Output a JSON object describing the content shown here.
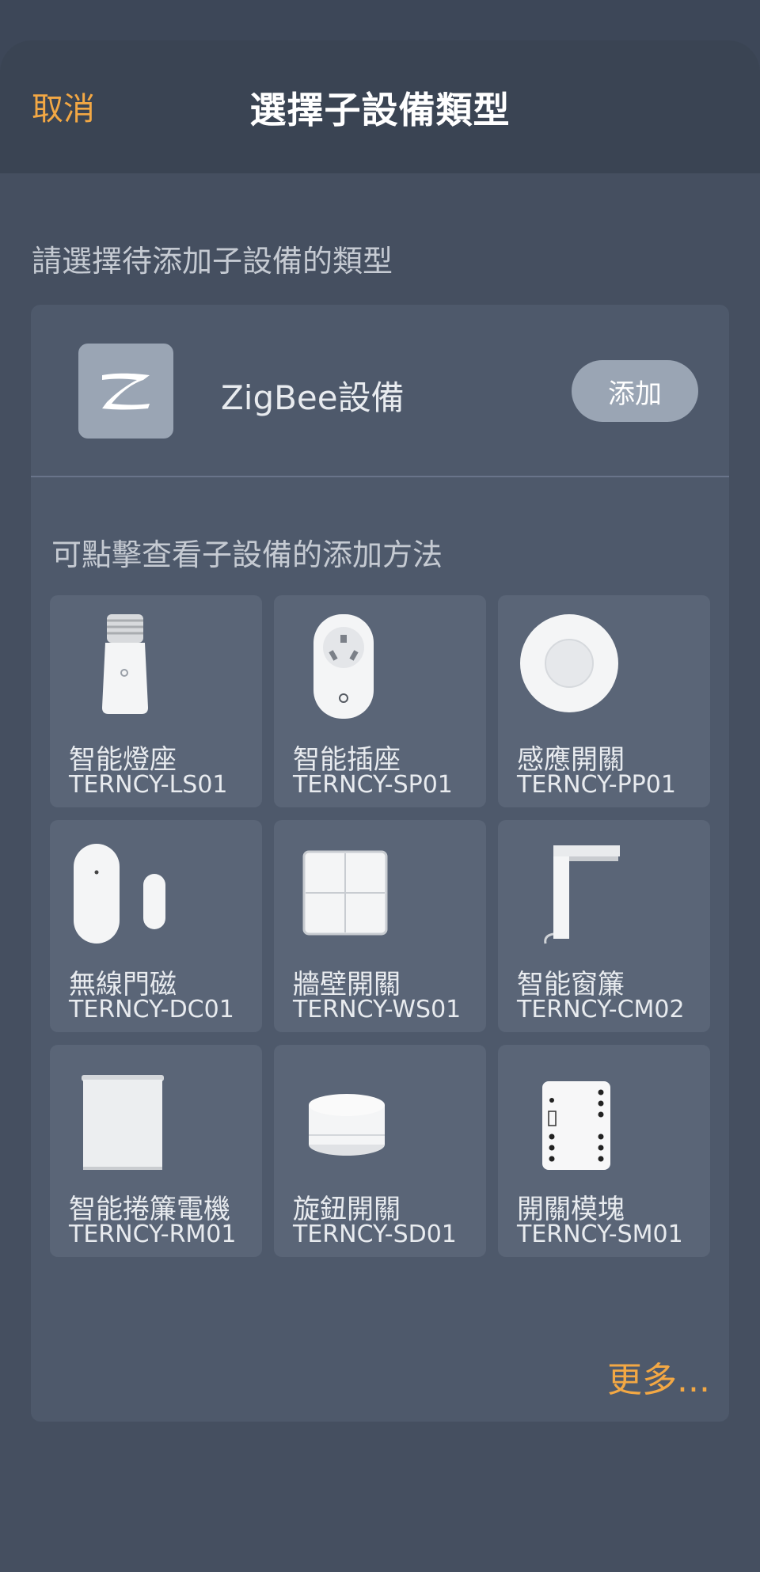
{
  "header": {
    "cancel_label": "取消",
    "title": "選擇子設備類型"
  },
  "section_hint": "請選擇待添加子設備的類型",
  "zigbee": {
    "name": "ZigBee設備",
    "add_label": "添加",
    "logo_icon": "zigbee-logo-icon"
  },
  "guide_hint": "可點擊查看子設備的添加方法",
  "devices": [
    {
      "name": "智能燈座",
      "model": "TERNCY-LS01",
      "icon": "lamp-holder-icon"
    },
    {
      "name": "智能插座",
      "model": "TERNCY-SP01",
      "icon": "smart-plug-icon"
    },
    {
      "name": "感應開關",
      "model": "TERNCY-PP01",
      "icon": "round-button-icon"
    },
    {
      "name": "無線門磁",
      "model": "TERNCY-DC01",
      "icon": "door-sensor-icon"
    },
    {
      "name": "牆壁開關",
      "model": "TERNCY-WS01",
      "icon": "wall-switch-icon"
    },
    {
      "name": "智能窗簾",
      "model": "TERNCY-CM02",
      "icon": "curtain-motor-icon"
    },
    {
      "name": "智能捲簾電機",
      "model": "TERNCY-RM01",
      "icon": "roller-blind-icon"
    },
    {
      "name": "旋鈕開關",
      "model": "TERNCY-SD01",
      "icon": "knob-switch-icon"
    },
    {
      "name": "開關模塊",
      "model": "TERNCY-SM01",
      "icon": "switch-module-icon"
    }
  ],
  "more_label": "更多...",
  "colors": {
    "accent": "#f3a844",
    "background": "#3c4656",
    "card": "#4e596b",
    "tile": "#5a6577",
    "button": "#9aa5b4"
  }
}
